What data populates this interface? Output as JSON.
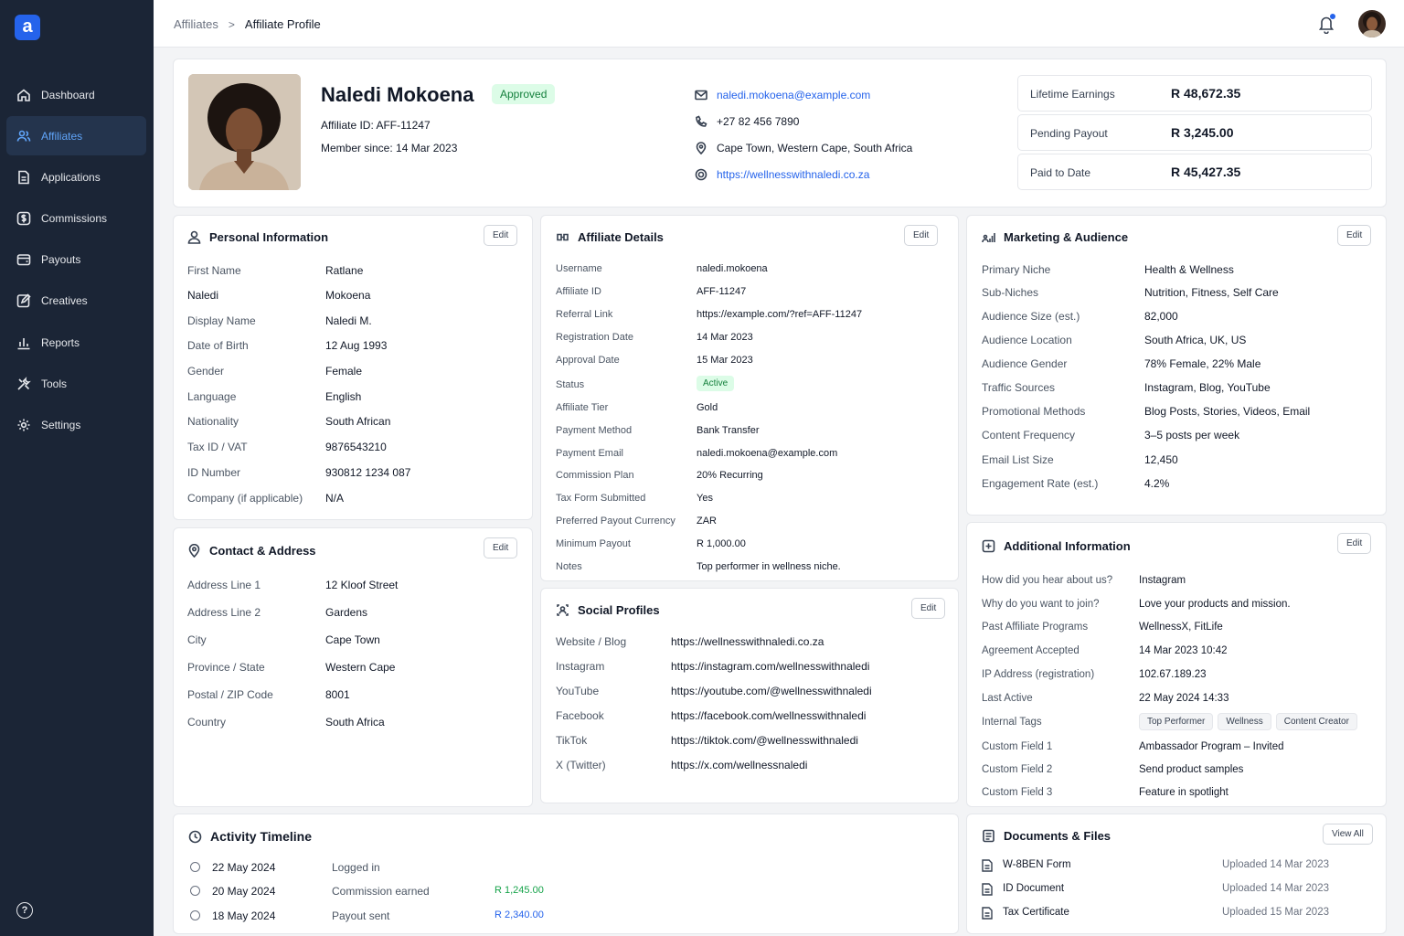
{
  "sidebar": {
    "logo": "a",
    "items": [
      {
        "label": "Dashboard",
        "icon": "home-icon"
      },
      {
        "label": "Affiliates",
        "icon": "users-icon",
        "active": true
      },
      {
        "label": "Applications",
        "icon": "file-icon"
      },
      {
        "label": "Commissions",
        "icon": "dollar-icon"
      },
      {
        "label": "Payouts",
        "icon": "wallet-icon"
      },
      {
        "label": "Creatives",
        "icon": "edit-square-icon"
      },
      {
        "label": "Reports",
        "icon": "bar-chart-icon"
      },
      {
        "label": "Tools",
        "icon": "tools-icon"
      },
      {
        "label": "Settings",
        "icon": "gear-icon"
      }
    ],
    "help": "?"
  },
  "header": {
    "breadcrumb_parent": "Affiliates",
    "breadcrumb_sep": ">",
    "breadcrumb_current": "Affiliate Profile"
  },
  "profile": {
    "name": "Naledi Mokoena",
    "status": "Approved",
    "affiliate_id": "Affiliate ID: AFF-11247",
    "member_since": "Member since: 14 Mar 2023",
    "email": "naledi.mokoena@example.com",
    "phone": "+27 82 456 7890",
    "location": "Cape Town, Western Cape, South Africa",
    "website": "https://wellnesswithnaledi.co.za",
    "stats": [
      {
        "label": "Lifetime Earnings",
        "value": "R 48,672.35"
      },
      {
        "label": "Pending Payout",
        "value": "R 3,245.00"
      },
      {
        "label": "Paid to Date",
        "value": "R 45,427.35"
      }
    ]
  },
  "personal": {
    "title": "Personal Information",
    "edit": "Edit",
    "rows": [
      {
        "k": "First Name",
        "v": "Ratlane"
      },
      {
        "k": "Naledi",
        "v": "Mokoena"
      },
      {
        "k": "Display Name",
        "v": "Naledi M."
      },
      {
        "k": "Date of Birth",
        "v": "12 Aug 1993"
      },
      {
        "k": "Gender",
        "v": "Female"
      },
      {
        "k": "Language",
        "v": "English"
      },
      {
        "k": "Nationality",
        "v": "South African"
      },
      {
        "k": "Tax ID / VAT",
        "v": "9876543210"
      },
      {
        "k": "ID Number",
        "v": "930812 1234 087"
      },
      {
        "k": "Company (if applicable)",
        "v": "N/A"
      }
    ]
  },
  "contact": {
    "title": "Contact & Address",
    "edit": "Edit",
    "rows": [
      {
        "k": "Address Line 1",
        "v": "12 Kloof Street"
      },
      {
        "k": "Address Line 2",
        "v": "Gardens"
      },
      {
        "k": "City",
        "v": "Cape Town"
      },
      {
        "k": "Province / State",
        "v": "Western Cape"
      },
      {
        "k": "Postal / ZIP Code",
        "v": "8001"
      },
      {
        "k": "Country",
        "v": "South Africa"
      }
    ]
  },
  "affiliate": {
    "title": "Affiliate Details",
    "edit": "Edit",
    "rows": [
      {
        "k": "Username",
        "v": "naledi.mokoena"
      },
      {
        "k": "Affiliate ID",
        "v": "AFF-11247"
      },
      {
        "k": "Referral Link",
        "v": "https://example.com/?ref=AFF-11247"
      },
      {
        "k": "Registration Date",
        "v": "14 Mar 2023"
      },
      {
        "k": "Approval Date",
        "v": "15 Mar 2023"
      },
      {
        "k": "Status",
        "v": "Active"
      },
      {
        "k": "Affiliate Tier",
        "v": "Gold"
      },
      {
        "k": "Payment Method",
        "v": "Bank Transfer"
      },
      {
        "k": "Payment Email",
        "v": "naledi.mokoena@example.com"
      },
      {
        "k": "Commission Plan",
        "v": "20% Recurring"
      },
      {
        "k": "Tax Form Submitted",
        "v": "Yes"
      },
      {
        "k": "Preferred Payout Currency",
        "v": "ZAR"
      },
      {
        "k": "Minimum Payout",
        "v": "R 1,000.00"
      },
      {
        "k": "Notes",
        "v": "Top performer in wellness niche."
      }
    ]
  },
  "social": {
    "title": "Social Profiles",
    "edit": "Edit",
    "rows": [
      {
        "k": "Website / Blog",
        "v": "https://wellnesswithnaledi.co.za"
      },
      {
        "k": "Instagram",
        "v": "https://instagram.com/wellnesswithnaledi"
      },
      {
        "k": "YouTube",
        "v": "https://youtube.com/@wellnesswithnaledi"
      },
      {
        "k": "Facebook",
        "v": "https://facebook.com/wellnesswithnaledi"
      },
      {
        "k": "TikTok",
        "v": "https://tiktok.com/@wellnesswithnaledi"
      },
      {
        "k": "X (Twitter)",
        "v": "https://x.com/wellnessnaledi"
      }
    ]
  },
  "marketing": {
    "title": "Marketing & Audience",
    "edit": "Edit",
    "rows": [
      {
        "k": "Primary Niche",
        "v": "Health & Wellness"
      },
      {
        "k": "Sub-Niches",
        "v": "Nutrition, Fitness, Self Care"
      },
      {
        "k": "Audience Size (est.)",
        "v": "82,000"
      },
      {
        "k": "Audience Location",
        "v": "South Africa, UK, US"
      },
      {
        "k": "Audience Gender",
        "v": "78% Female, 22% Male"
      },
      {
        "k": "Traffic Sources",
        "v": "Instagram, Blog, YouTube"
      },
      {
        "k": "Promotional Methods",
        "v": "Blog Posts, Stories, Videos, Email"
      },
      {
        "k": "Content Frequency",
        "v": "3–5 posts per week"
      },
      {
        "k": "Email List Size",
        "v": "12,450"
      },
      {
        "k": "Engagement Rate (est.)",
        "v": "4.2%"
      }
    ]
  },
  "additional": {
    "title": "Additional Information",
    "edit": "Edit",
    "rows": [
      {
        "k": "How did you hear about us?",
        "v": "Instagram"
      },
      {
        "k": "Why do you want to join?",
        "v": "Love your products and mission."
      },
      {
        "k": "Past Affiliate Programs",
        "v": "WellnessX, FitLife"
      },
      {
        "k": "Agreement Accepted",
        "v": "14 Mar 2023 10:42"
      },
      {
        "k": "IP Address (registration)",
        "v": "102.67.189.23"
      },
      {
        "k": "Last Active",
        "v": "22 May 2024 14:33"
      },
      {
        "k": "Internal Tags",
        "v": ""
      },
      {
        "k": "Custom Field 1",
        "v": "Ambassador Program – Invited"
      },
      {
        "k": "Custom Field 2",
        "v": "Send product samples"
      },
      {
        "k": "Custom Field 3",
        "v": "Feature in spotlight"
      }
    ],
    "tags": [
      "Top Performer",
      "Wellness",
      "Content Creator"
    ]
  },
  "timeline": {
    "title": "Activity Timeline",
    "rows": [
      {
        "date": "22 May 2024",
        "event": "Logged in",
        "amount": ""
      },
      {
        "date": "20 May 2024",
        "event": "Commission earned",
        "amount": "R 1,245.00"
      },
      {
        "date": "18 May 2024",
        "event": "Payout sent",
        "amount": "R 2,340.00"
      }
    ],
    "colors": {
      "commission": "#16a34a",
      "payout": "#2563eb"
    }
  },
  "documents": {
    "title": "Documents & Files",
    "view_all": "View All",
    "rows": [
      {
        "name": "W-8BEN Form",
        "uploaded": "Uploaded 14 Mar 2023"
      },
      {
        "name": "ID Document",
        "uploaded": "Uploaded 14 Mar 2023"
      },
      {
        "name": "Tax Certificate",
        "uploaded": "Uploaded 15 Mar 2023"
      }
    ]
  },
  "colors": {
    "sidebar": "#1b2536",
    "accent": "#2563eb",
    "approved_bg": "#dcfce7",
    "approved_text": "#15803d"
  }
}
